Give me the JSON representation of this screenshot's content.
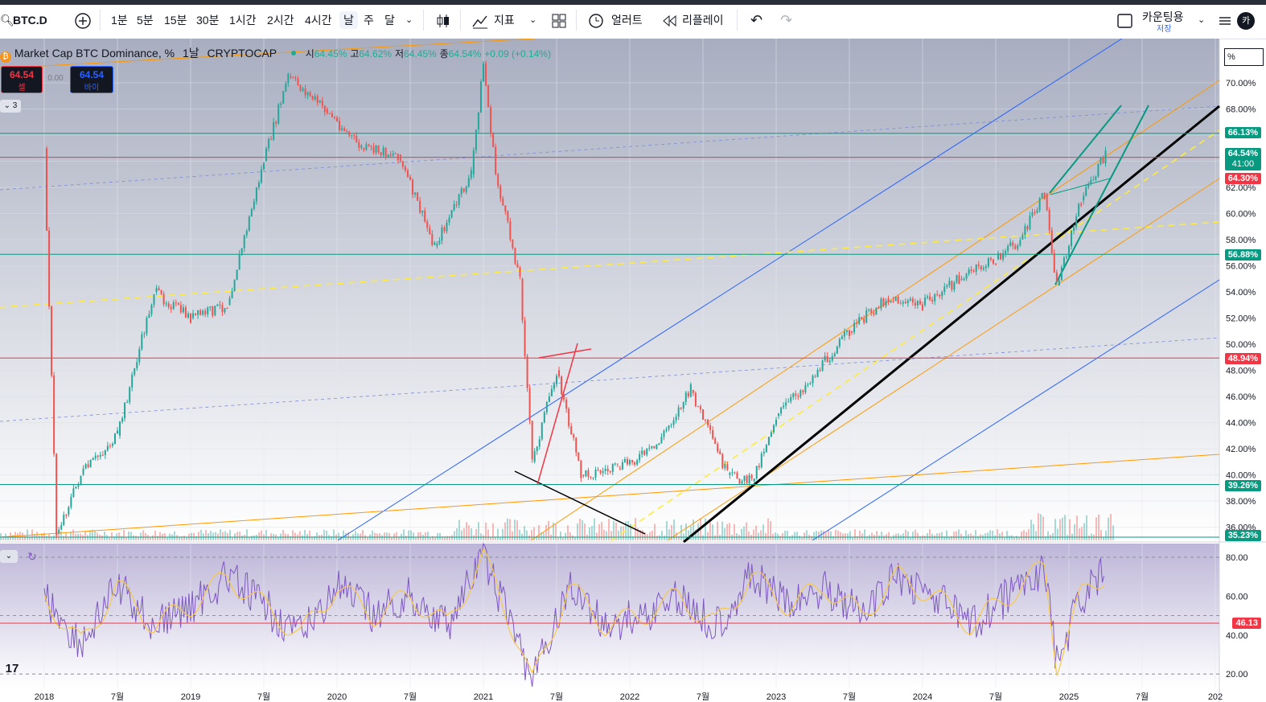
{
  "toolbar": {
    "symbol": "BTC.D",
    "intervals": [
      "1분",
      "5분",
      "15분",
      "30분",
      "1시간",
      "2시간",
      "4시간",
      "날",
      "주",
      "달"
    ],
    "selected_interval": "날",
    "indicators_label": "지표",
    "alert_label": "얼러트",
    "replay_label": "리플레이",
    "layout_name": "카운팅용",
    "layout_sub": "저장",
    "avatar_letter": "카"
  },
  "legend": {
    "title": "Market Cap BTC Dominance, %",
    "interval": "1날",
    "source": "CRYPTOCAP",
    "o_label": "시",
    "o_val": "64.45%",
    "h_label": "고",
    "h_val": "64.62%",
    "l_label": "저",
    "l_val": "64.45%",
    "c_label": "종",
    "c_val": "64.54%",
    "change": "+0.09 (+0.14%)",
    "sell_price": "64.54",
    "sell_label": "셀",
    "spread": "0.00",
    "buy_price": "64.54",
    "buy_label": "바이",
    "indicator_count": "3"
  },
  "price_axis": {
    "unit": "%",
    "current_price": "64.54%",
    "countdown": "41:00",
    "labels": [
      {
        "text": "66.13%",
        "color": "#089981"
      },
      {
        "text": "64.30%",
        "color": "#f23645"
      },
      {
        "text": "56.88%",
        "color": "#089981"
      },
      {
        "text": "48.94%",
        "color": "#f23645"
      },
      {
        "text": "39.26%",
        "color": "#089981"
      },
      {
        "text": "35.23%",
        "color": "#089981"
      }
    ],
    "rsi_label": "46.13"
  },
  "chart_data": [
    {
      "type": "line",
      "title": "Market Cap BTC Dominance, %",
      "x": [
        "2018-01",
        "2018-02",
        "2018-04",
        "2018-07",
        "2018-10",
        "2019-01",
        "2019-04",
        "2019-07",
        "2019-09",
        "2019-12",
        "2020-03",
        "2020-06",
        "2020-09",
        "2020-12",
        "2021-01",
        "2021-02",
        "2021-04",
        "2021-05",
        "2021-07",
        "2021-09",
        "2021-12",
        "2022-03",
        "2022-06",
        "2022-09",
        "2022-11",
        "2023-01",
        "2023-04",
        "2023-07",
        "2023-10",
        "2024-01",
        "2024-04",
        "2024-07",
        "2024-09",
        "2024-11",
        "2024-12",
        "2025-02",
        "2025-04"
      ],
      "series": [
        {
          "values": [
            65.0,
            35.5,
            40.0,
            43.0,
            54.0,
            52.0,
            53.0,
            64.0,
            70.5,
            68.0,
            65.0,
            64.5,
            57.5,
            63.0,
            71.5,
            63.0,
            55.0,
            41.0,
            48.0,
            40.0,
            40.5,
            42.0,
            46.5,
            40.0,
            39.5,
            44.5,
            47.5,
            51.0,
            53.5,
            53.0,
            55.0,
            56.5,
            58.0,
            61.5,
            54.5,
            61.0,
            64.54
          ]
        }
      ],
      "ylim": [
        35,
        71
      ],
      "y_ticks": [
        "36.00%",
        "38.00%",
        "40.00%",
        "42.00%",
        "44.00%",
        "46.00%",
        "48.00%",
        "50.00%",
        "52.00%",
        "54.00%",
        "56.00%",
        "58.00%",
        "60.00%",
        "62.00%",
        "64.00%",
        "66.00%",
        "68.00%",
        "70.00%"
      ],
      "x_ticks": [
        "2018",
        "7월",
        "2019",
        "7월",
        "2020",
        "7월",
        "2021",
        "7월",
        "2022",
        "7월",
        "2023",
        "7월",
        "2024",
        "7월",
        "2025",
        "7월",
        "202"
      ],
      "horizontal_levels": [
        {
          "value": 66.13,
          "color": "#089981"
        },
        {
          "value": 64.3,
          "color": "#f23645"
        },
        {
          "value": 56.88,
          "color": "#089981"
        },
        {
          "value": 48.94,
          "color": "#f23645"
        },
        {
          "value": 39.26,
          "color": "#089981"
        },
        {
          "value": 35.23,
          "color": "#089981"
        }
      ]
    },
    {
      "type": "line",
      "x": [
        "2018-01",
        "2018-04",
        "2018-07",
        "2018-10",
        "2019-01",
        "2019-04",
        "2019-07",
        "2019-10",
        "2020-01",
        "2020-04",
        "2020-07",
        "2020-10",
        "2021-01",
        "2021-04",
        "2021-05",
        "2021-08",
        "2021-11",
        "2022-02",
        "2022-05",
        "2022-08",
        "2022-11",
        "2023-02",
        "2023-05",
        "2023-08",
        "2023-11",
        "2024-02",
        "2024-05",
        "2024-08",
        "2024-11",
        "2024-12",
        "2025-02",
        "2025-04"
      ],
      "series": [
        {
          "name": "RSI",
          "values": [
            60,
            35,
            65,
            45,
            55,
            70,
            55,
            40,
            65,
            50,
            60,
            45,
            80,
            35,
            15,
            65,
            45,
            50,
            60,
            45,
            70,
            55,
            65,
            50,
            70,
            60,
            45,
            60,
            75,
            25,
            60,
            72
          ]
        }
      ],
      "ylim": [
        15,
        85
      ],
      "y_ticks": [
        "20.00",
        "40.00",
        "60.00",
        "80.00"
      ],
      "current_value": "46.13"
    }
  ]
}
